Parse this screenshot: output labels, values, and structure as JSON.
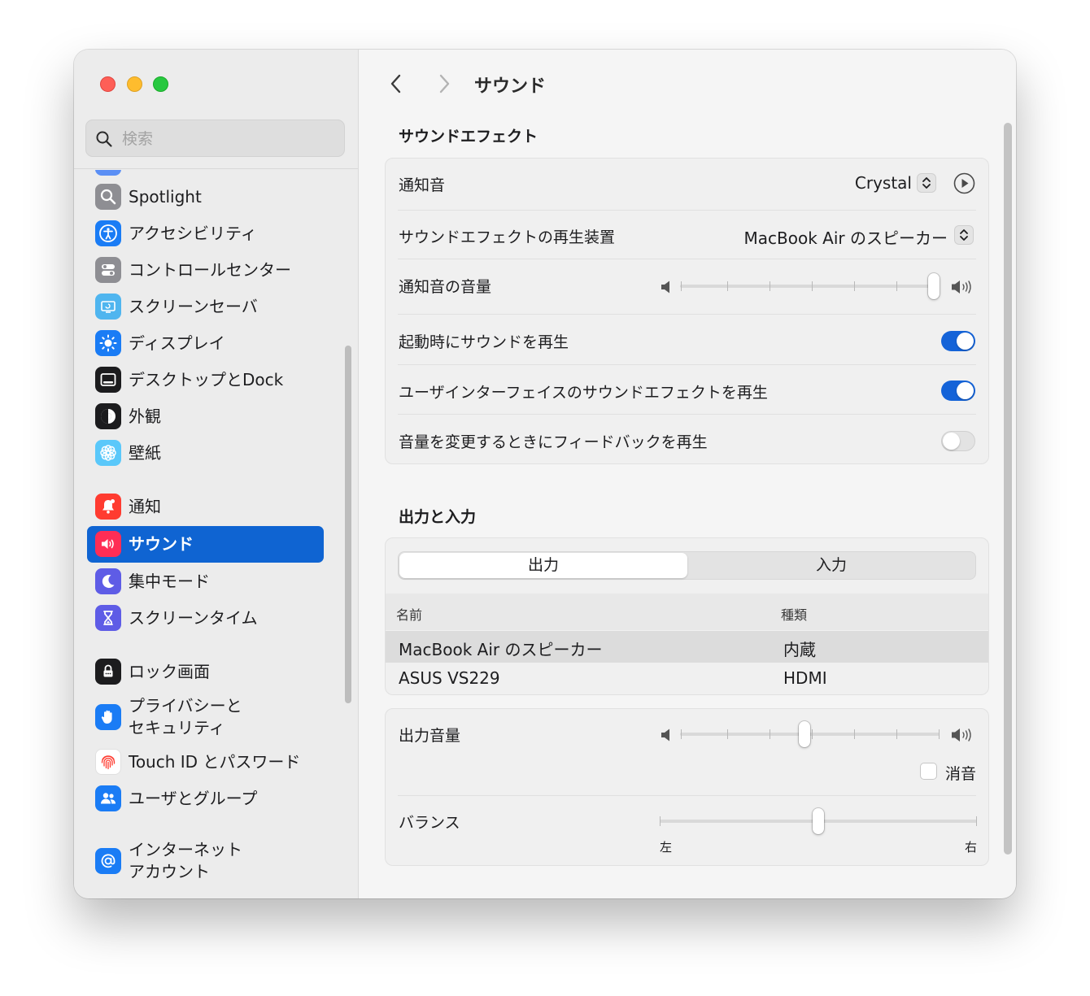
{
  "search": {
    "placeholder": "検索"
  },
  "sidebar": {
    "items": [
      {
        "label": "Spotlight",
        "icon": "spotlight-icon",
        "color": "#8e8e93"
      },
      {
        "label": "アクセシビリティ",
        "icon": "accessibility-icon",
        "color": "#1a7cf5"
      },
      {
        "label": "コントロールセンター",
        "icon": "control-center-icon",
        "color": "#8e8e93"
      },
      {
        "label": "スクリーンセーバ",
        "icon": "screensaver-icon",
        "color": "#4fb5ef"
      },
      {
        "label": "ディスプレイ",
        "icon": "display-icon",
        "color": "#1a7cf5"
      },
      {
        "label": "デスクトップとDock",
        "icon": "desktop-dock-icon",
        "color": "#1c1c1e"
      },
      {
        "label": "外観",
        "icon": "appearance-icon",
        "color": "#1c1c1e"
      },
      {
        "label": "壁紙",
        "icon": "wallpaper-icon",
        "color": "#5ac8fa"
      },
      {
        "label": "通知",
        "icon": "notifications-icon",
        "color": "#ff3b30"
      },
      {
        "label": "サウンド",
        "icon": "sound-icon",
        "color": "#ff2d55",
        "active": true
      },
      {
        "label": "集中モード",
        "icon": "focus-icon",
        "color": "#5e5ce6"
      },
      {
        "label": "スクリーンタイム",
        "icon": "screen-time-icon",
        "color": "#5e5ce6"
      },
      {
        "label": "ロック画面",
        "icon": "lock-screen-icon",
        "color": "#1c1c1e"
      },
      {
        "label": "プライバシーと\nセキュリティ",
        "icon": "privacy-hand-icon",
        "color": "#1a7cf5"
      },
      {
        "label": "Touch ID とパスワード",
        "icon": "fingerprint-icon",
        "color": "#ff3b30"
      },
      {
        "label": "ユーザとグループ",
        "icon": "users-groups-icon",
        "color": "#1a7cf5"
      },
      {
        "label": "インターネット\nアカウント",
        "icon": "internet-accounts-icon",
        "color": "#1a7cf5"
      }
    ]
  },
  "main": {
    "title": "サウンド",
    "sound_effects": {
      "title": "サウンドエフェクト",
      "alert_sound": {
        "label": "通知音",
        "value": "Crystal"
      },
      "play_through": {
        "label": "サウンドエフェクトの再生装置",
        "value": "MacBook Air のスピーカー"
      },
      "alert_volume": {
        "label": "通知音の音量",
        "level": 1.0
      },
      "startup_sound": {
        "label": "起動時にサウンドを再生",
        "on": true
      },
      "ui_sound": {
        "label": "ユーザインターフェイスのサウンドエフェクトを再生",
        "on": true
      },
      "feedback": {
        "label": "音量を変更するときにフィードバックを再生",
        "on": false
      }
    },
    "output_input": {
      "title": "出力と入力",
      "tabs": [
        "出力",
        "入力"
      ],
      "selected_tab": "出力",
      "columns": [
        "名前",
        "種類"
      ],
      "devices": [
        {
          "name": "MacBook Air のスピーカー",
          "type": "内蔵",
          "selected": true
        },
        {
          "name": "ASUS VS229",
          "type": "HDMI",
          "selected": false
        }
      ]
    },
    "output_volume": {
      "label": "出力音量",
      "level": 0.48,
      "mute_label": "消音",
      "muted": false
    },
    "balance": {
      "label": "バランス",
      "level": 0.5,
      "left_label": "左",
      "right_label": "右"
    }
  },
  "colors": {
    "accent": "#0f64d2",
    "toggle_on": "#1463d8"
  }
}
